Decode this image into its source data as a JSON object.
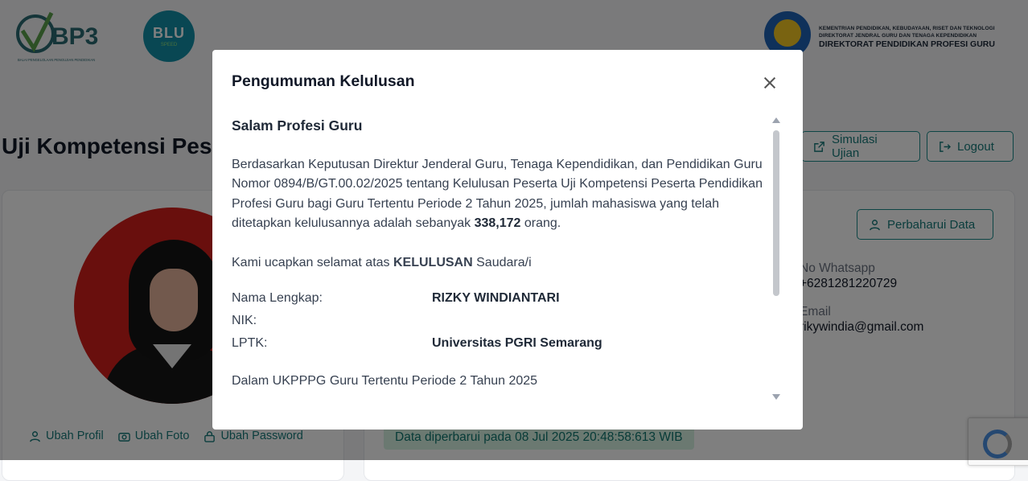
{
  "header": {
    "bp3_logo_text": "BP3",
    "bp3_logo_sub": "BALAI PENGELOLAAN PENGUJIAN PENDIDIKAN",
    "blu_logo_text": "BLU",
    "blu_logo_sub": "SPEED",
    "ministry_line1": "KEMENTRIAN PENDIDIKAN, KEBUDAYAAN, RISET DAN TEKNOLOGI",
    "ministry_line2": "DIREKTORAT JENDRAL GURU DAN TENAGA KEPENDIDIKAN",
    "ministry_line3": "DIREKTORAT PENDIDIKAN PROFESI GURU"
  },
  "page": {
    "title": "Uji Kompetensi Pes",
    "simulasi_label": "Simulasi Ujian",
    "logout_label": "Logout",
    "update_label": "Perbaharui Data",
    "links": {
      "profile": "Ubah Profil",
      "photo": "Ubah Foto",
      "password": "Ubah Password"
    },
    "whatsapp_label": "No Whatsapp",
    "whatsapp_value": "+6281281220729",
    "email_label": "Email",
    "email_value": "rikywindia@gmail.com",
    "updated_text": "Data diperbarui pada 08 Jul 2025 20:48:58:613 WIB"
  },
  "modal": {
    "title": "Pengumuman Kelulusan",
    "greeting": "Salam Profesi Guru",
    "paragraph_part1": "Berdasarkan Keputusan Direktur Jenderal Guru, Tenaga Kependidikan, dan Pendidikan Guru Nomor 0894/B/GT.00.02/2025 tentang Kelulusan Peserta Uji Kompetensi Peserta Pendidikan Profesi Guru bagi Guru Tertentu Periode 2 Tahun 2025, jumlah mahasiswa yang telah ditetapkan kelulusannya adalah sebanyak",
    "graduate_count": "338,172",
    "paragraph_part2": "orang.",
    "congrats_part1": "Kami ucapkan selamat atas",
    "congrats_bold": "KELULUSAN",
    "congrats_part2": "Saudara/i",
    "fields": [
      {
        "label": "Nama Lengkap:",
        "value": "RIZKY WINDIANTARI"
      },
      {
        "label": "NIK:",
        "value": ""
      },
      {
        "label": "LPTK:",
        "value": "Universitas PGRI Semarang"
      }
    ],
    "period_text": "Dalam UKPPPG Guru Tertentu Periode 2 Tahun 2025"
  }
}
